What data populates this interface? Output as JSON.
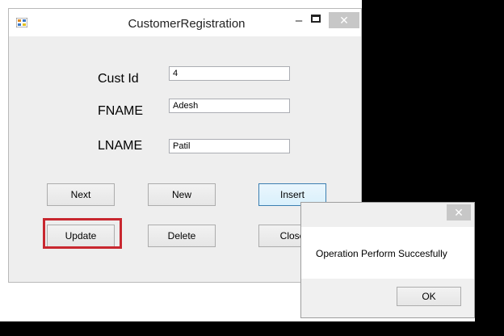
{
  "window": {
    "title": "CustomerRegistration",
    "close_glyph": "✕",
    "minimize_glyph": "–"
  },
  "form": {
    "cust_id_label": "Cust Id",
    "cust_id_value": "4",
    "fname_label": "FNAME",
    "fname_value": "Adesh",
    "lname_label": "LNAME",
    "lname_value": "Patil"
  },
  "buttons": {
    "next": "Next",
    "new": "New",
    "insert": "Insert",
    "update": "Update",
    "delete": "Delete",
    "close": "Close"
  },
  "message_box": {
    "text": "Operation Perform Succesfully",
    "ok": "OK",
    "close_glyph": "✕"
  },
  "colors": {
    "highlight": "#c8272f",
    "focus_border": "#3c7fb1"
  }
}
